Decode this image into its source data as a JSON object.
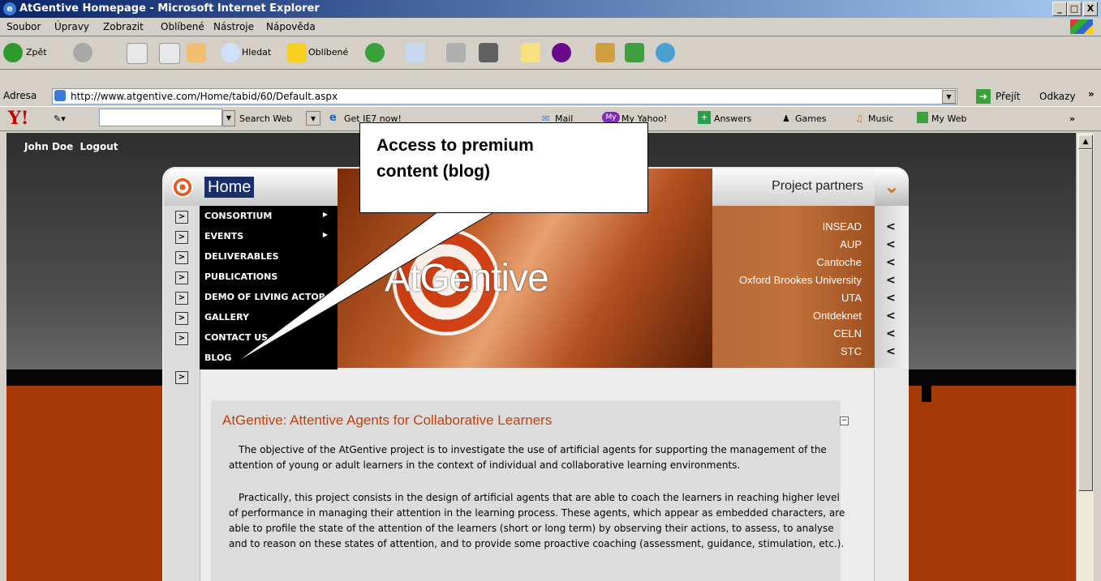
{
  "window": {
    "title": "AtGentive Homepage - Microsoft Internet Explorer",
    "min": "_",
    "max": "□",
    "close": "X"
  },
  "menu": [
    "Soubor",
    "Úpravy",
    "Zobrazit",
    "Oblíbené",
    "Nástroje",
    "Nápověda"
  ],
  "toolbar": {
    "back": "Zpět",
    "search": "Hledat",
    "favorites": "Oblíbené"
  },
  "address": {
    "label": "Adresa",
    "url": "http://www.atgentive.com/Home/tabid/60/Default.aspx",
    "go": "Přejít",
    "links": "Odkazy"
  },
  "yahoo": {
    "search_web": "Search Web",
    "ie7": "Get IE7 now!",
    "mail": "Mail",
    "my_yahoo": "My Yahoo!",
    "answers": "Answers",
    "games": "Games",
    "music": "Music",
    "my_web": "My Web"
  },
  "page": {
    "user": "John Doe",
    "logout": "Logout",
    "home": "Home",
    "logo": "AtGentive",
    "partners_title": "Project partners",
    "partners": [
      "INSEAD",
      "AUP",
      "Cantoche",
      "Oxford Brookes University",
      "UTA",
      "Ontdeknet",
      "CELN",
      "STC"
    ],
    "nav": [
      "CONSORTIUM",
      "EVENTS",
      "DELIVERABLES",
      "PUBLICATIONS",
      "DEMO OF LIVING ACTOR",
      "GALLERY",
      "CONTACT US",
      "BLOG"
    ],
    "module_title": "AtGentive: Attentive Agents for Collaborative Learners",
    "para1": "The objective of the AtGentive project is to investigate the use of artificial agents for supporting the management of the attention of young or adult learners in the context of individual and collaborative learning environments.",
    "para2": "Practically, this project consists in the design of artificial agents that are able to coach the learners in reaching higher level of performance in managing their attention in the learning process. These agents, which appear as embedded characters, are able to profile the state of the attention of the learners (short or long term) by observing their actions, to assess, to analyse and to reason on these states of attention, and to provide some proactive coaching (assessment, guidance, stimulation, etc.)."
  },
  "callout": {
    "line1": "Access to premium",
    "line2": "content (blog)"
  }
}
